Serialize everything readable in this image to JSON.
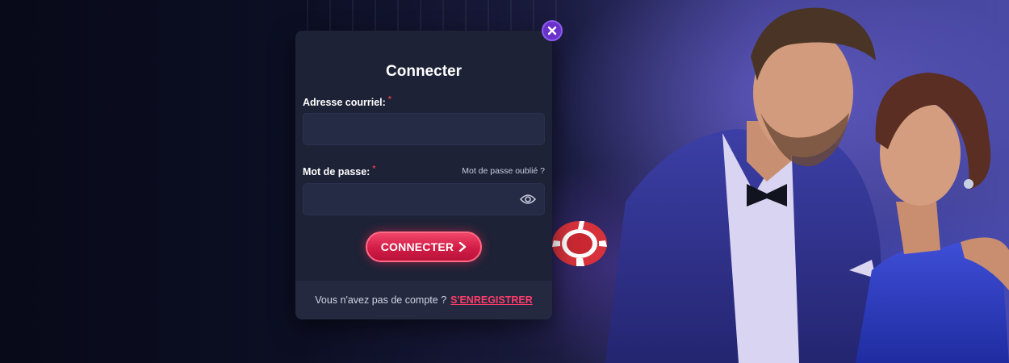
{
  "modal": {
    "title": "Connecter",
    "email_label": "Adresse courriel:",
    "email_value": "",
    "password_label": "Mot de passe:",
    "password_value": "",
    "required_marker": "*",
    "forgot_password": "Mot de passe oublié ?",
    "submit_label": "CONNECTER",
    "footer_text": "Vous n'avez pas de compte ?",
    "register_link": "S'ENREGISTRER"
  },
  "icons": {
    "close": "close-icon",
    "show_password": "eye-icon",
    "submit_chevron": "chevron-right-icon"
  },
  "colors": {
    "modal_bg": "#1e2236",
    "input_bg": "#262b45",
    "accent": "#d21d46",
    "link": "#ff3d6b",
    "close_button": "#6a32c9"
  }
}
